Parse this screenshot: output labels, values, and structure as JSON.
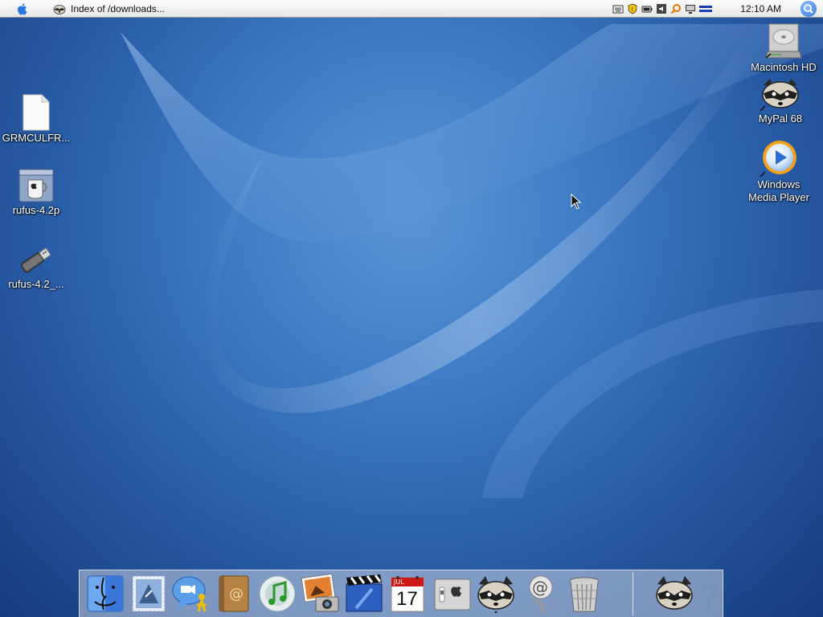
{
  "menubar": {
    "window_title": "Index of /downloads...",
    "clock": "12:10 AM"
  },
  "desktop_icons_left": [
    {
      "label": "GRMCULFR...",
      "icon": "blank-document-icon"
    },
    {
      "label": "rufus-4.2p",
      "icon": "coffee-mug-app-icon"
    },
    {
      "label": "rufus-4.2_...",
      "icon": "usb-drive-icon"
    }
  ],
  "desktop_icons_right": [
    {
      "label": "Macintosh HD",
      "icon": "hard-drive-icon"
    },
    {
      "label": "MyPal 68",
      "icon": "raccoon-browser-icon"
    },
    {
      "label": "Windows Media Player",
      "label_line1": "Windows",
      "label_line2": "Media Player",
      "icon": "media-player-icon"
    }
  ],
  "dock_items": [
    {
      "name": "finder",
      "icon": "finder-icon"
    },
    {
      "name": "mail",
      "icon": "mail-stamp-icon"
    },
    {
      "name": "ichat",
      "icon": "ichat-icon"
    },
    {
      "name": "address-book",
      "icon": "address-book-icon"
    },
    {
      "name": "itunes",
      "icon": "itunes-icon"
    },
    {
      "name": "iphoto",
      "icon": "iphoto-icon"
    },
    {
      "name": "imovie",
      "icon": "imovie-icon"
    },
    {
      "name": "ical",
      "icon": "ical-icon",
      "month": "JUL",
      "day": "17"
    },
    {
      "name": "system-preferences",
      "icon": "system-preferences-icon"
    },
    {
      "name": "mypal",
      "icon": "raccoon-browser-icon"
    },
    {
      "name": "mail-server",
      "icon": "mail-at-icon"
    },
    {
      "name": "trash",
      "icon": "trash-icon"
    },
    {
      "name": "mypal-minimized",
      "icon": "raccoon-browser-icon"
    },
    {
      "name": "help",
      "icon": "help-question-icon"
    }
  ],
  "colors": {
    "desktop_blue": "#2a5ea8",
    "menubar": "#ececec",
    "label_text": "#ffffff"
  }
}
